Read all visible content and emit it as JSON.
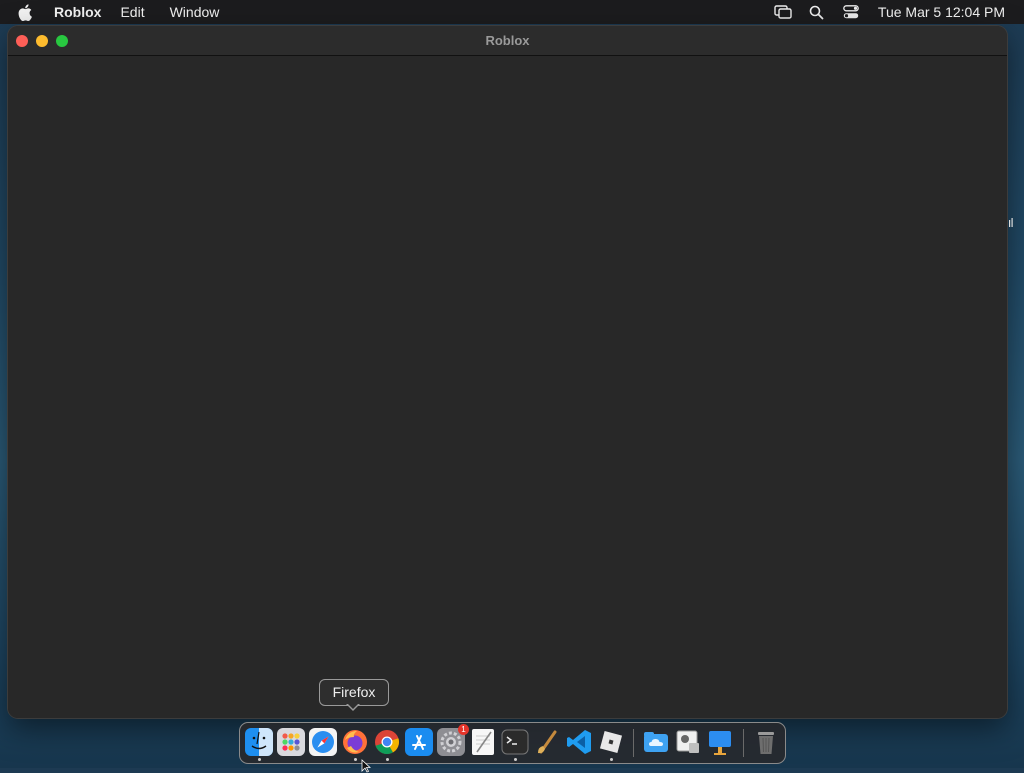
{
  "menubar": {
    "app_name": "Roblox",
    "items": [
      "Edit",
      "Window"
    ],
    "clock": "Tue Mar 5  12:04 PM",
    "status_icons": [
      "screen-mirroring-icon",
      "spotlight-search-icon",
      "control-center-icon"
    ]
  },
  "window": {
    "title": "Roblox"
  },
  "tooltip": {
    "text": "Firefox"
  },
  "dock": {
    "apps": [
      {
        "name": "Finder",
        "icon": "finder-icon",
        "running": true
      },
      {
        "name": "Launchpad",
        "icon": "launchpad-icon",
        "running": false
      },
      {
        "name": "Safari",
        "icon": "safari-icon",
        "running": false
      },
      {
        "name": "Firefox",
        "icon": "firefox-icon",
        "running": true
      },
      {
        "name": "Chrome",
        "icon": "chrome-icon",
        "running": true
      },
      {
        "name": "App Store",
        "icon": "app-store-icon",
        "running": false
      },
      {
        "name": "System Settings",
        "icon": "system-settings-icon",
        "running": false,
        "badge": "1"
      },
      {
        "name": "TextEdit",
        "icon": "textedit-icon",
        "running": false
      },
      {
        "name": "Terminal",
        "icon": "terminal-icon",
        "running": true
      },
      {
        "name": "Roblox Studio",
        "icon": "roblox-studio-icon",
        "running": false
      },
      {
        "name": "Visual Studio Code",
        "icon": "vscode-icon",
        "running": false
      },
      {
        "name": "Roblox",
        "icon": "roblox-icon",
        "running": true
      }
    ],
    "others": [
      {
        "name": "iCloud Drive",
        "icon": "icloud-folder-icon"
      },
      {
        "name": "Preview",
        "icon": "preview-icon"
      },
      {
        "name": "Keynote",
        "icon": "keynote-icon"
      }
    ],
    "trash": {
      "name": "Trash",
      "icon": "trash-icon"
    }
  },
  "colors": {
    "close": "#fe5f57",
    "minimize": "#febc2e",
    "maximize": "#28c840",
    "badge": "#e5342a"
  }
}
